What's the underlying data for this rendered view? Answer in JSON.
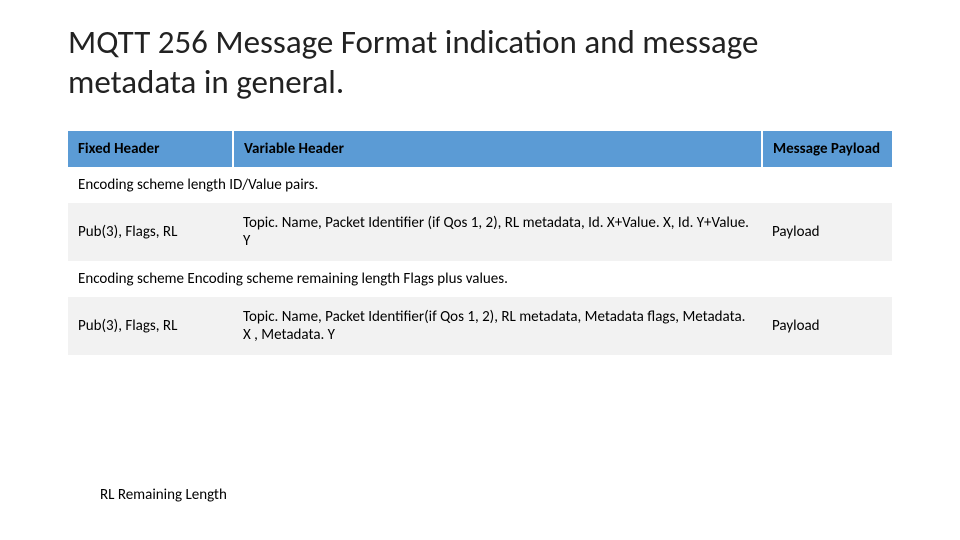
{
  "title": "MQTT 256 Message Format indication and message metadata in general.",
  "headers": {
    "col1": "Fixed Header",
    "col2": "Variable Header",
    "col3": "Message Payload"
  },
  "rows": [
    {
      "kind": "span",
      "text": "Encoding scheme length ID/Value pairs."
    },
    {
      "kind": "body",
      "c1": "Pub(3), Flags, RL",
      "c2": "Topic. Name, Packet Identifier (if Qos 1, 2), RL metadata, Id. X+Value. X, Id. Y+Value. Y",
      "c3": "Payload"
    },
    {
      "kind": "span",
      "text": "Encoding scheme Encoding scheme remaining length Flags plus values."
    },
    {
      "kind": "body",
      "c1": "Pub(3), Flags, RL",
      "c2": "Topic. Name, Packet Identifier(if Qos 1, 2), RL metadata, Metadata flags, Metadata. X , Metadata. Y",
      "c3": "Payload"
    }
  ],
  "footnote": "RL Remaining Length",
  "chart_data": {
    "type": "table",
    "title": "MQTT 256 Message Format indication and message metadata in general.",
    "columns": [
      "Fixed Header",
      "Variable Header",
      "Message Payload"
    ],
    "sections": [
      {
        "heading": "Encoding scheme length ID/Value pairs.",
        "rows": [
          [
            "Pub(3), Flags, RL",
            "Topic. Name, Packet Identifier (if Qos 1, 2), RL metadata, Id. X+Value. X, Id. Y+Value. Y",
            "Payload"
          ]
        ]
      },
      {
        "heading": "Encoding scheme Encoding scheme remaining length Flags plus values.",
        "rows": [
          [
            "Pub(3), Flags, RL",
            "Topic. Name, Packet Identifier(if Qos 1, 2), RL metadata, Metadata flags, Metadata. X , Metadata. Y",
            "Payload"
          ]
        ]
      }
    ],
    "footnote": "RL Remaining Length"
  }
}
